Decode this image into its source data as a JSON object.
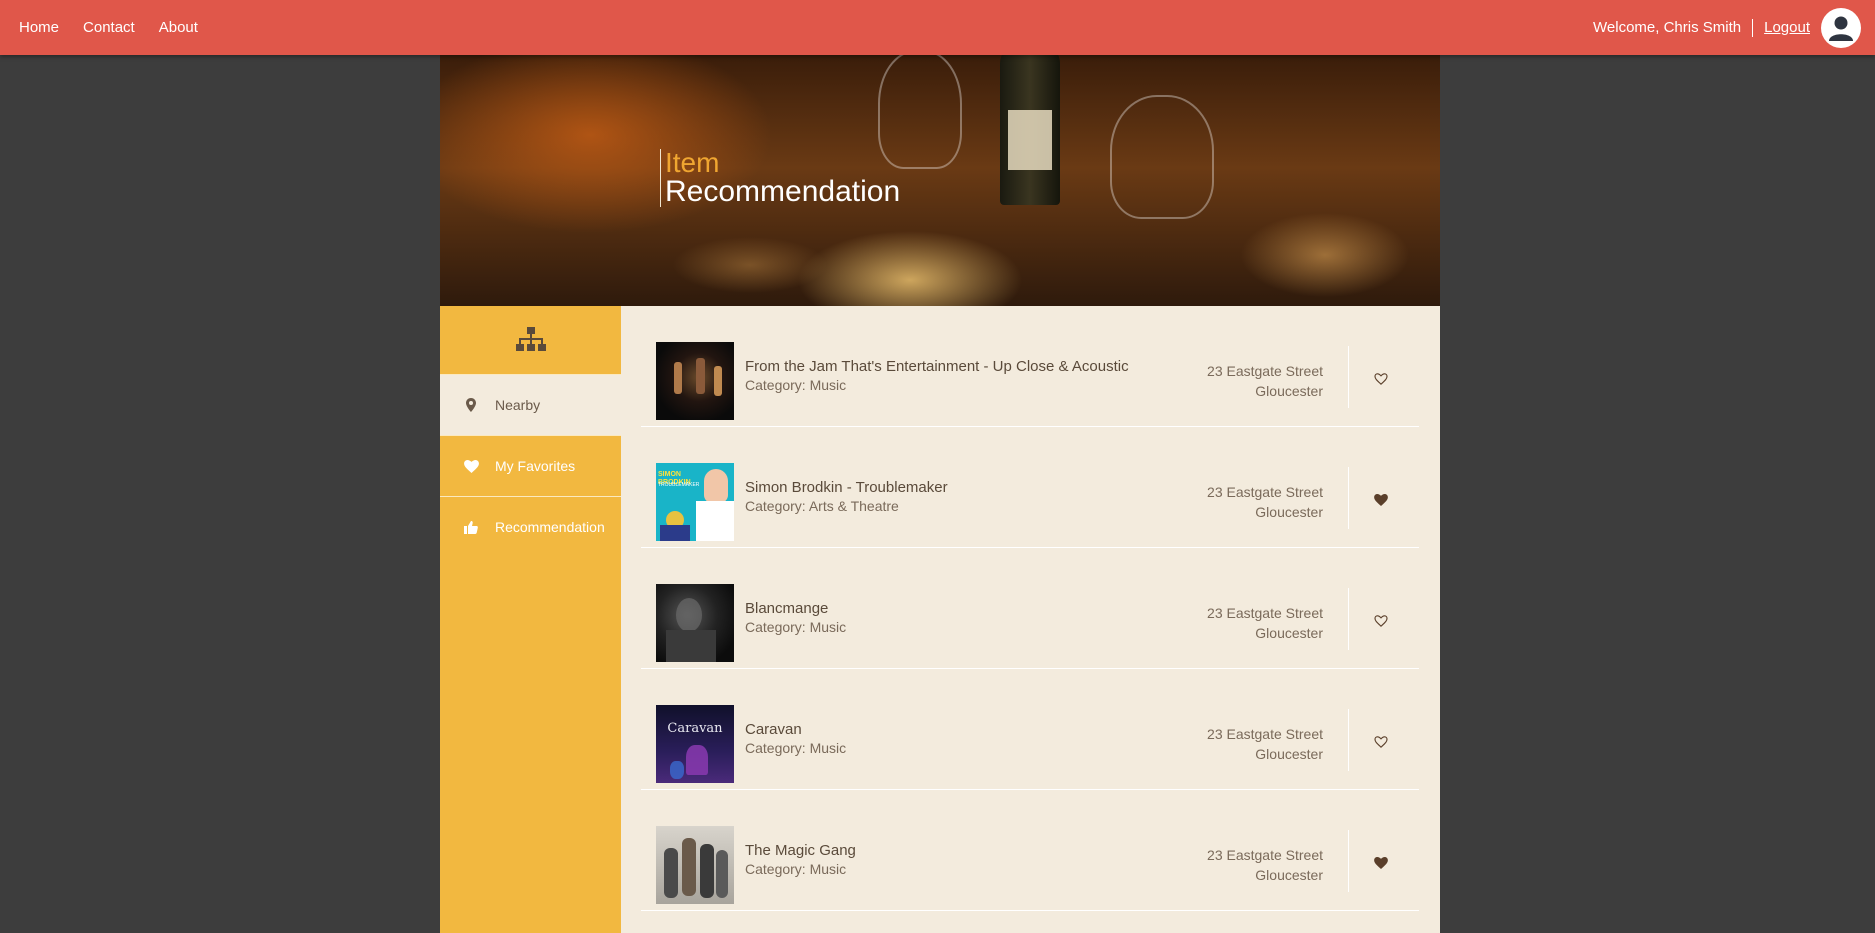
{
  "nav": {
    "home": "Home",
    "contact": "Contact",
    "about": "About"
  },
  "user": {
    "welcome": "Welcome, Chris Smith",
    "logout": "Logout"
  },
  "hero": {
    "line1": "Item",
    "line2": "Recommendation"
  },
  "sidebar": {
    "items": [
      {
        "label": "Nearby",
        "icon": "map-marker-icon",
        "active": true
      },
      {
        "label": "My Favorites",
        "icon": "heart-icon"
      },
      {
        "label": "Recommendation",
        "icon": "thumbs-up-icon"
      }
    ]
  },
  "items": [
    {
      "title": "From the Jam That's Entertainment - Up Close & Acoustic",
      "category": "Category: Music",
      "address_line1": "23 Eastgate Street",
      "address_line2": "Gloucester",
      "favorite": false
    },
    {
      "title": "Simon Brodkin - Troublemaker",
      "category": "Category: Arts & Theatre",
      "address_line1": "23 Eastgate Street",
      "address_line2": "Gloucester",
      "favorite": true,
      "thumb_text_1": "SIMON BRODKIN",
      "thumb_text_2": "TROUBLEMAKER"
    },
    {
      "title": "Blancmange",
      "category": "Category: Music",
      "address_line1": "23 Eastgate Street",
      "address_line2": "Gloucester",
      "favorite": false
    },
    {
      "title": "Caravan",
      "category": "Category: Music",
      "address_line1": "23 Eastgate Street",
      "address_line2": "Gloucester",
      "favorite": false,
      "thumb_text_1": "Caravan"
    },
    {
      "title": "The Magic Gang",
      "category": "Category: Music",
      "address_line1": "23 Eastgate Street",
      "address_line2": "Gloucester",
      "favorite": true
    }
  ],
  "colors": {
    "topbar": "#e0574a",
    "sidebar": "#f2b840",
    "content": "#f3ebdd",
    "accent": "#f0a631",
    "heart": "#5a3f2a"
  }
}
